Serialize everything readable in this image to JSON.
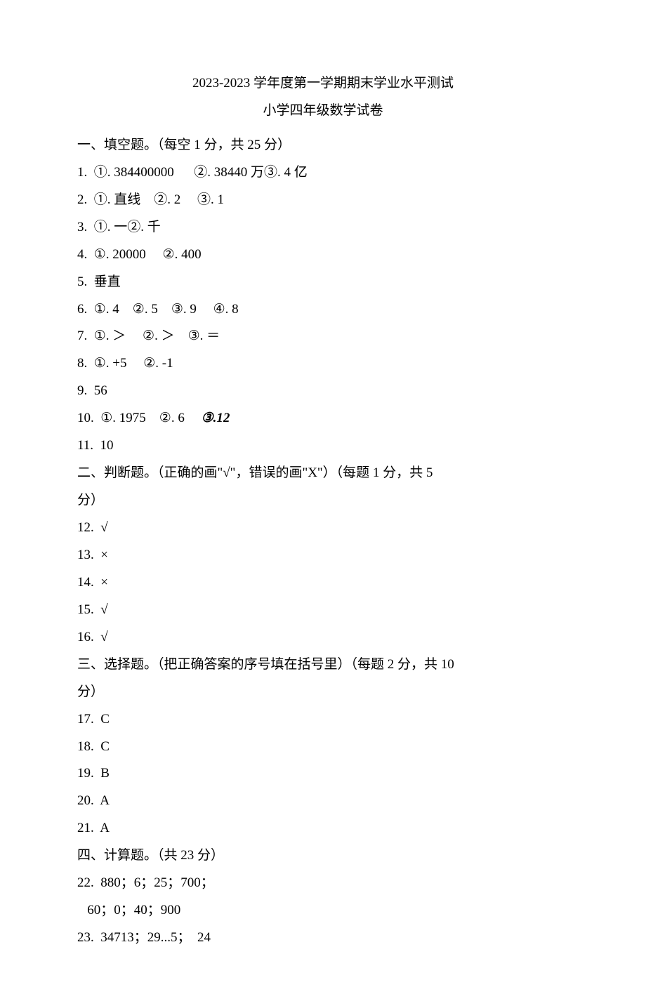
{
  "header": {
    "title1": "2023-2023 学年度第一学期期末学业水平测试",
    "title2": "小学四年级数学试卷"
  },
  "sections": {
    "s1": {
      "heading": "一、填空题。（每空 1 分，共 25 分）",
      "q1": "1.  ①. 384400000      ②. 38440 万③. 4 亿",
      "q2": "2.  ①. 直线    ②. 2     ③. 1",
      "q3": "3.  ①. 一②. 千",
      "q4": "4.  ①. 20000     ②. 400",
      "q5": "5.  垂直",
      "q6": "6.  ①. 4    ②. 5    ③. 9     ④. 8",
      "q7": "7.  ①. ＞     ②. ＞    ③. ＝",
      "q8": "8.  ①. +5     ②. -1",
      "q9": "9.  56",
      "q10a": "10.  ①. 1975    ②. 6     ",
      "q10b": "③.12",
      "q11": "11.  10"
    },
    "s2": {
      "heading": "二、判断题。（正确的画\"√\"，错误的画\"X\"）（每题 1 分，共 5",
      "heading2": "分）",
      "q12": "12.  √",
      "q13": "13.  ×",
      "q14": "14.  ×",
      "q15": "15.  √",
      "q16": "16.  √"
    },
    "s3": {
      "heading": "三、选择题。（把正确答案的序号填在括号里）（每题 2 分，共 10",
      "heading2": "分）",
      "q17": "17.  C",
      "q18": "18.  C",
      "q19": "19.  B",
      "q20": "20.  A",
      "q21": "21.  A"
    },
    "s4": {
      "heading": "四、计算题。（共 23 分）",
      "q22a": "22.  880；6；25；700；",
      "q22b": "   60；0；40；900",
      "q23": "23.  34713；29...5；  24"
    }
  }
}
